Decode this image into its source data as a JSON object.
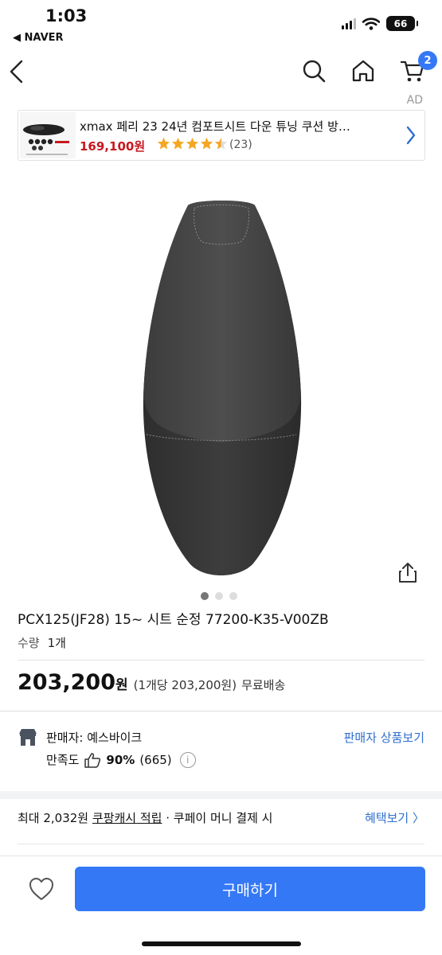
{
  "status_bar": {
    "time": "1:03",
    "back_app": "◀ NAVER",
    "battery": "66"
  },
  "nav": {
    "cart_badge": "2"
  },
  "ad": {
    "label": "AD",
    "title": "xmax 페리 23 24년 컴포트시트 다운 튜닝 쿠션 방…",
    "price": "169,100원",
    "rating": 4.5,
    "review_count": "(23)"
  },
  "gallery": {
    "dot_count": 3,
    "active_index": 0
  },
  "product": {
    "title": "PCX125(JF28) 15~ 시트 순정 77200-K35-V00ZB",
    "qty_label": "수량",
    "qty_value": "1개",
    "price": "203,200",
    "price_unit": "원",
    "unit_price_note": "(1개당 203,200원)",
    "shipping": "무료배송"
  },
  "seller": {
    "name": "판매자: 예스바이크",
    "link": "판매자 상품보기",
    "satisfaction_label": "만족도",
    "satisfaction_pct": "90%",
    "satisfaction_count": "(665)"
  },
  "cash": {
    "prefix": "최대 2,032원 ",
    "highlight": "쿠팡캐시 적립",
    "suffix": " · 쿠페이 머니 결제 시",
    "benefit_link": "혜택보기 〉"
  },
  "footer": {
    "buy_label": "구매하기"
  },
  "colors": {
    "accent": "#3478f6",
    "link": "#2f6fcf",
    "ad_price": "#c7181f",
    "star": "#f5a623"
  }
}
